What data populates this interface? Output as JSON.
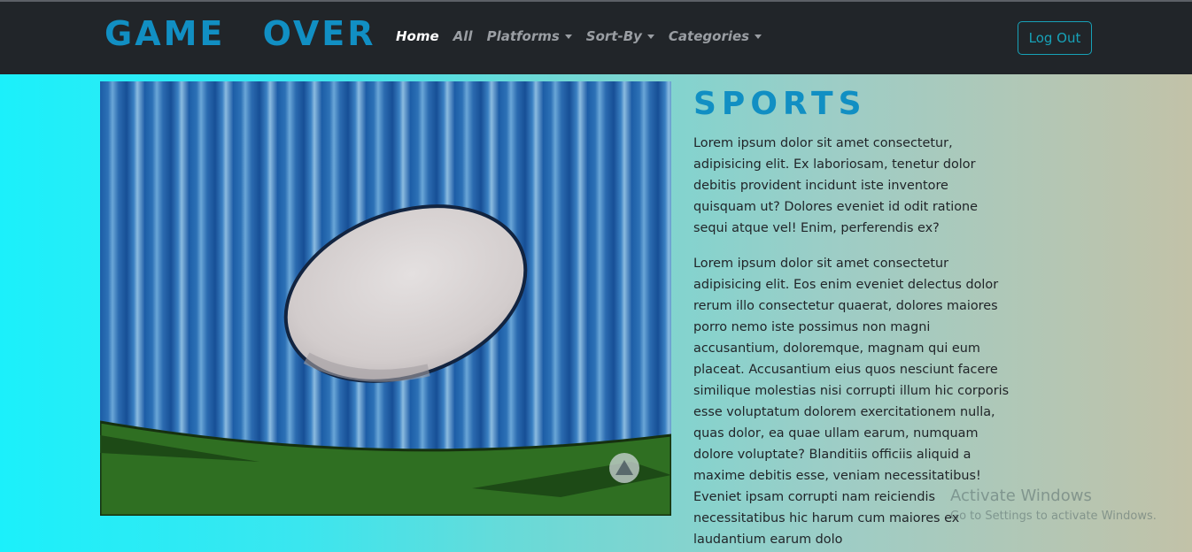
{
  "navbar": {
    "brand": "GAME OVER",
    "items": [
      {
        "label": "Home",
        "active": true,
        "dropdown": false
      },
      {
        "label": "All",
        "active": false,
        "dropdown": false
      },
      {
        "label": "Platforms",
        "active": false,
        "dropdown": true
      },
      {
        "label": "Sort-By",
        "active": false,
        "dropdown": true
      },
      {
        "label": "Categories",
        "active": false,
        "dropdown": true
      }
    ],
    "logout_label": "Log Out"
  },
  "content": {
    "title": "SPORTS",
    "paragraphs": [
      "Lorem ipsum dolor sit amet consectetur, adipisicing elit. Ex laboriosam, tenetur dolor debitis provident incidunt iste inventore quisquam ut? Dolores eveniet id odit ratione sequi atque vel! Enim, perferendis ex?",
      "Lorem ipsum dolor sit amet consectetur adipisicing elit. Eos enim eveniet delectus dolor rerum illo consectetur quaerat, dolores maiores porro nemo iste possimus non magni accusantium, doloremque, magnam qui eum placeat. Accusantium eius quos nesciunt facere similique molestias nisi corrupti illum hic corporis esse voluptatum dolorem exercitationem nulla, quas dolor, ea quae ullam earum, numquam dolore voluptate? Blanditiis officiis aliquid a maxime debitis esse, veniam necessitatibus! Eveniet ipsam corrupti nam reiciendis necessitatibus hic harum cum maiores ex laudantium earum dolo"
    ]
  },
  "watermark": {
    "line1": "Activate Windows",
    "line2": "Go to Settings to activate Windows."
  },
  "colors": {
    "navbar_bg": "#212529",
    "brand": "#118fc3",
    "logout_border": "#17a2b8"
  }
}
